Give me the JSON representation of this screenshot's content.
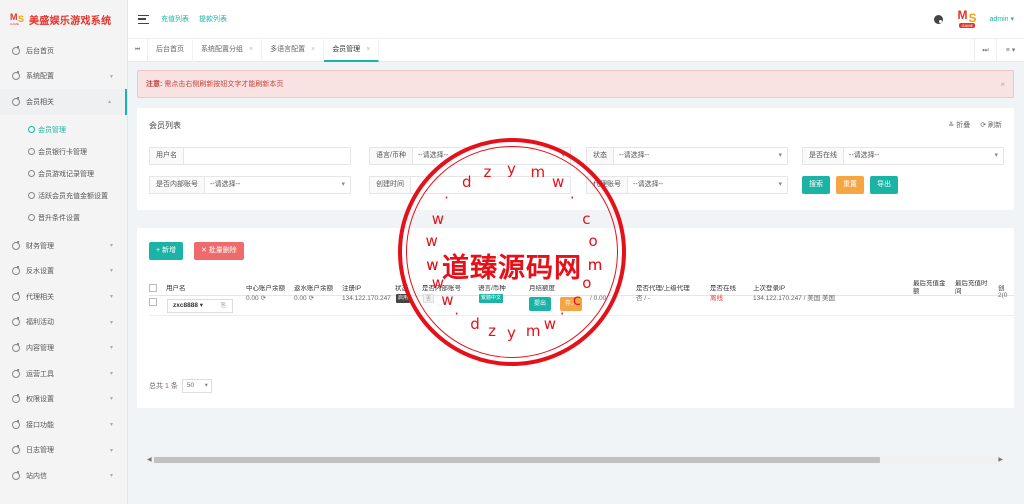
{
  "brand": {
    "name": "美盛娱乐游戏系统",
    "logo_m": "M",
    "logo_s": "S",
    "logo_small": "GAME"
  },
  "header": {
    "links": [
      "充值列表",
      "提款列表"
    ],
    "user": "admin ▾",
    "avatar_m": "M",
    "avatar_s": "S",
    "avatar_small": "GAME"
  },
  "sidebar": {
    "items": [
      {
        "label": "后台首页"
      },
      {
        "label": "系统配置"
      },
      {
        "label": "会员相关"
      },
      {
        "label": "财务管理"
      },
      {
        "label": "反水设置"
      },
      {
        "label": "代理相关"
      },
      {
        "label": "福利活动"
      },
      {
        "label": "内容管理"
      },
      {
        "label": "运营工具"
      },
      {
        "label": "权限设置"
      },
      {
        "label": "接口功能"
      },
      {
        "label": "日志管理"
      },
      {
        "label": "站内信"
      }
    ],
    "submenu": [
      "会员管理",
      "会员银行卡管理",
      "会员游戏记录管理",
      "活跃会员充值金额设置",
      "晋升条件设置"
    ]
  },
  "tabs": [
    {
      "label": "后台首页"
    },
    {
      "label": "系统配置分组"
    },
    {
      "label": "多语言配置"
    },
    {
      "label": "会员管理"
    }
  ],
  "tab_nav": {
    "prev": "⏮",
    "next": "⏭",
    "menu": "≡ ▾",
    "close": "×"
  },
  "alert": {
    "prefix": "注意:",
    "text": "需点击右侧刷新按钮文字才能刷新本页",
    "close": "×"
  },
  "search": {
    "title": "会员列表",
    "fold": "≚ 折叠",
    "refresh": "⟳ 刷新",
    "fields": {
      "username": {
        "label": "用户名",
        "value": ""
      },
      "lang": {
        "label": "语言/币种",
        "value": "--请选择--"
      },
      "status": {
        "label": "状态",
        "value": "--请选择--"
      },
      "online": {
        "label": "是否在线",
        "value": "--请选择--"
      },
      "internal": {
        "label": "是否内部账号",
        "value": "--请选择--"
      },
      "created": {
        "label": "创建时间",
        "value": ""
      },
      "agent": {
        "label": "代理账号",
        "value": "--请选择--"
      }
    },
    "buttons": {
      "search": "搜索",
      "reset": "重置",
      "export": "导出"
    }
  },
  "table": {
    "toolbar": {
      "add": "+ 新增",
      "batch_delete": "✕ 批量删除"
    },
    "headers": [
      "用户名",
      "中心账户余额",
      "返水账户余额",
      "注册IP",
      "状态",
      "是否内部账号",
      "语言/币种",
      "月结额度",
      "是否代理/上级代理",
      "是否在线",
      "上次登录IP",
      "最后充值金额",
      "最后充值时间",
      "创"
    ],
    "rows": [
      {
        "username": "zxc8888 ▾",
        "center_balance": "0.00",
        "rebate_balance": "0.00",
        "reg_ip": "134.122.170.247",
        "status": "启用",
        "internal": "否",
        "lang": "繁體中文",
        "limit_out": "提出",
        "limit_in": "存入",
        "limit_value": "/ 0.00",
        "agent": "否 / -",
        "online": "离线",
        "last_ip": "134.122.170.247 / 美国 美国",
        "last_amount": "",
        "last_time": "",
        "created": "2(0"
      }
    ],
    "footer": {
      "prefix": "总共",
      "count": "1",
      "suffix": "条",
      "page_size": "50"
    }
  },
  "watermark": {
    "main": "道臻源码网",
    "ring_chars": [
      "w",
      "w",
      "w",
      "·",
      "d",
      "z",
      "y",
      "m",
      "w",
      "·",
      "c",
      "o",
      "m"
    ]
  },
  "scrollbar": {
    "left": "◀",
    "right": "▶"
  }
}
